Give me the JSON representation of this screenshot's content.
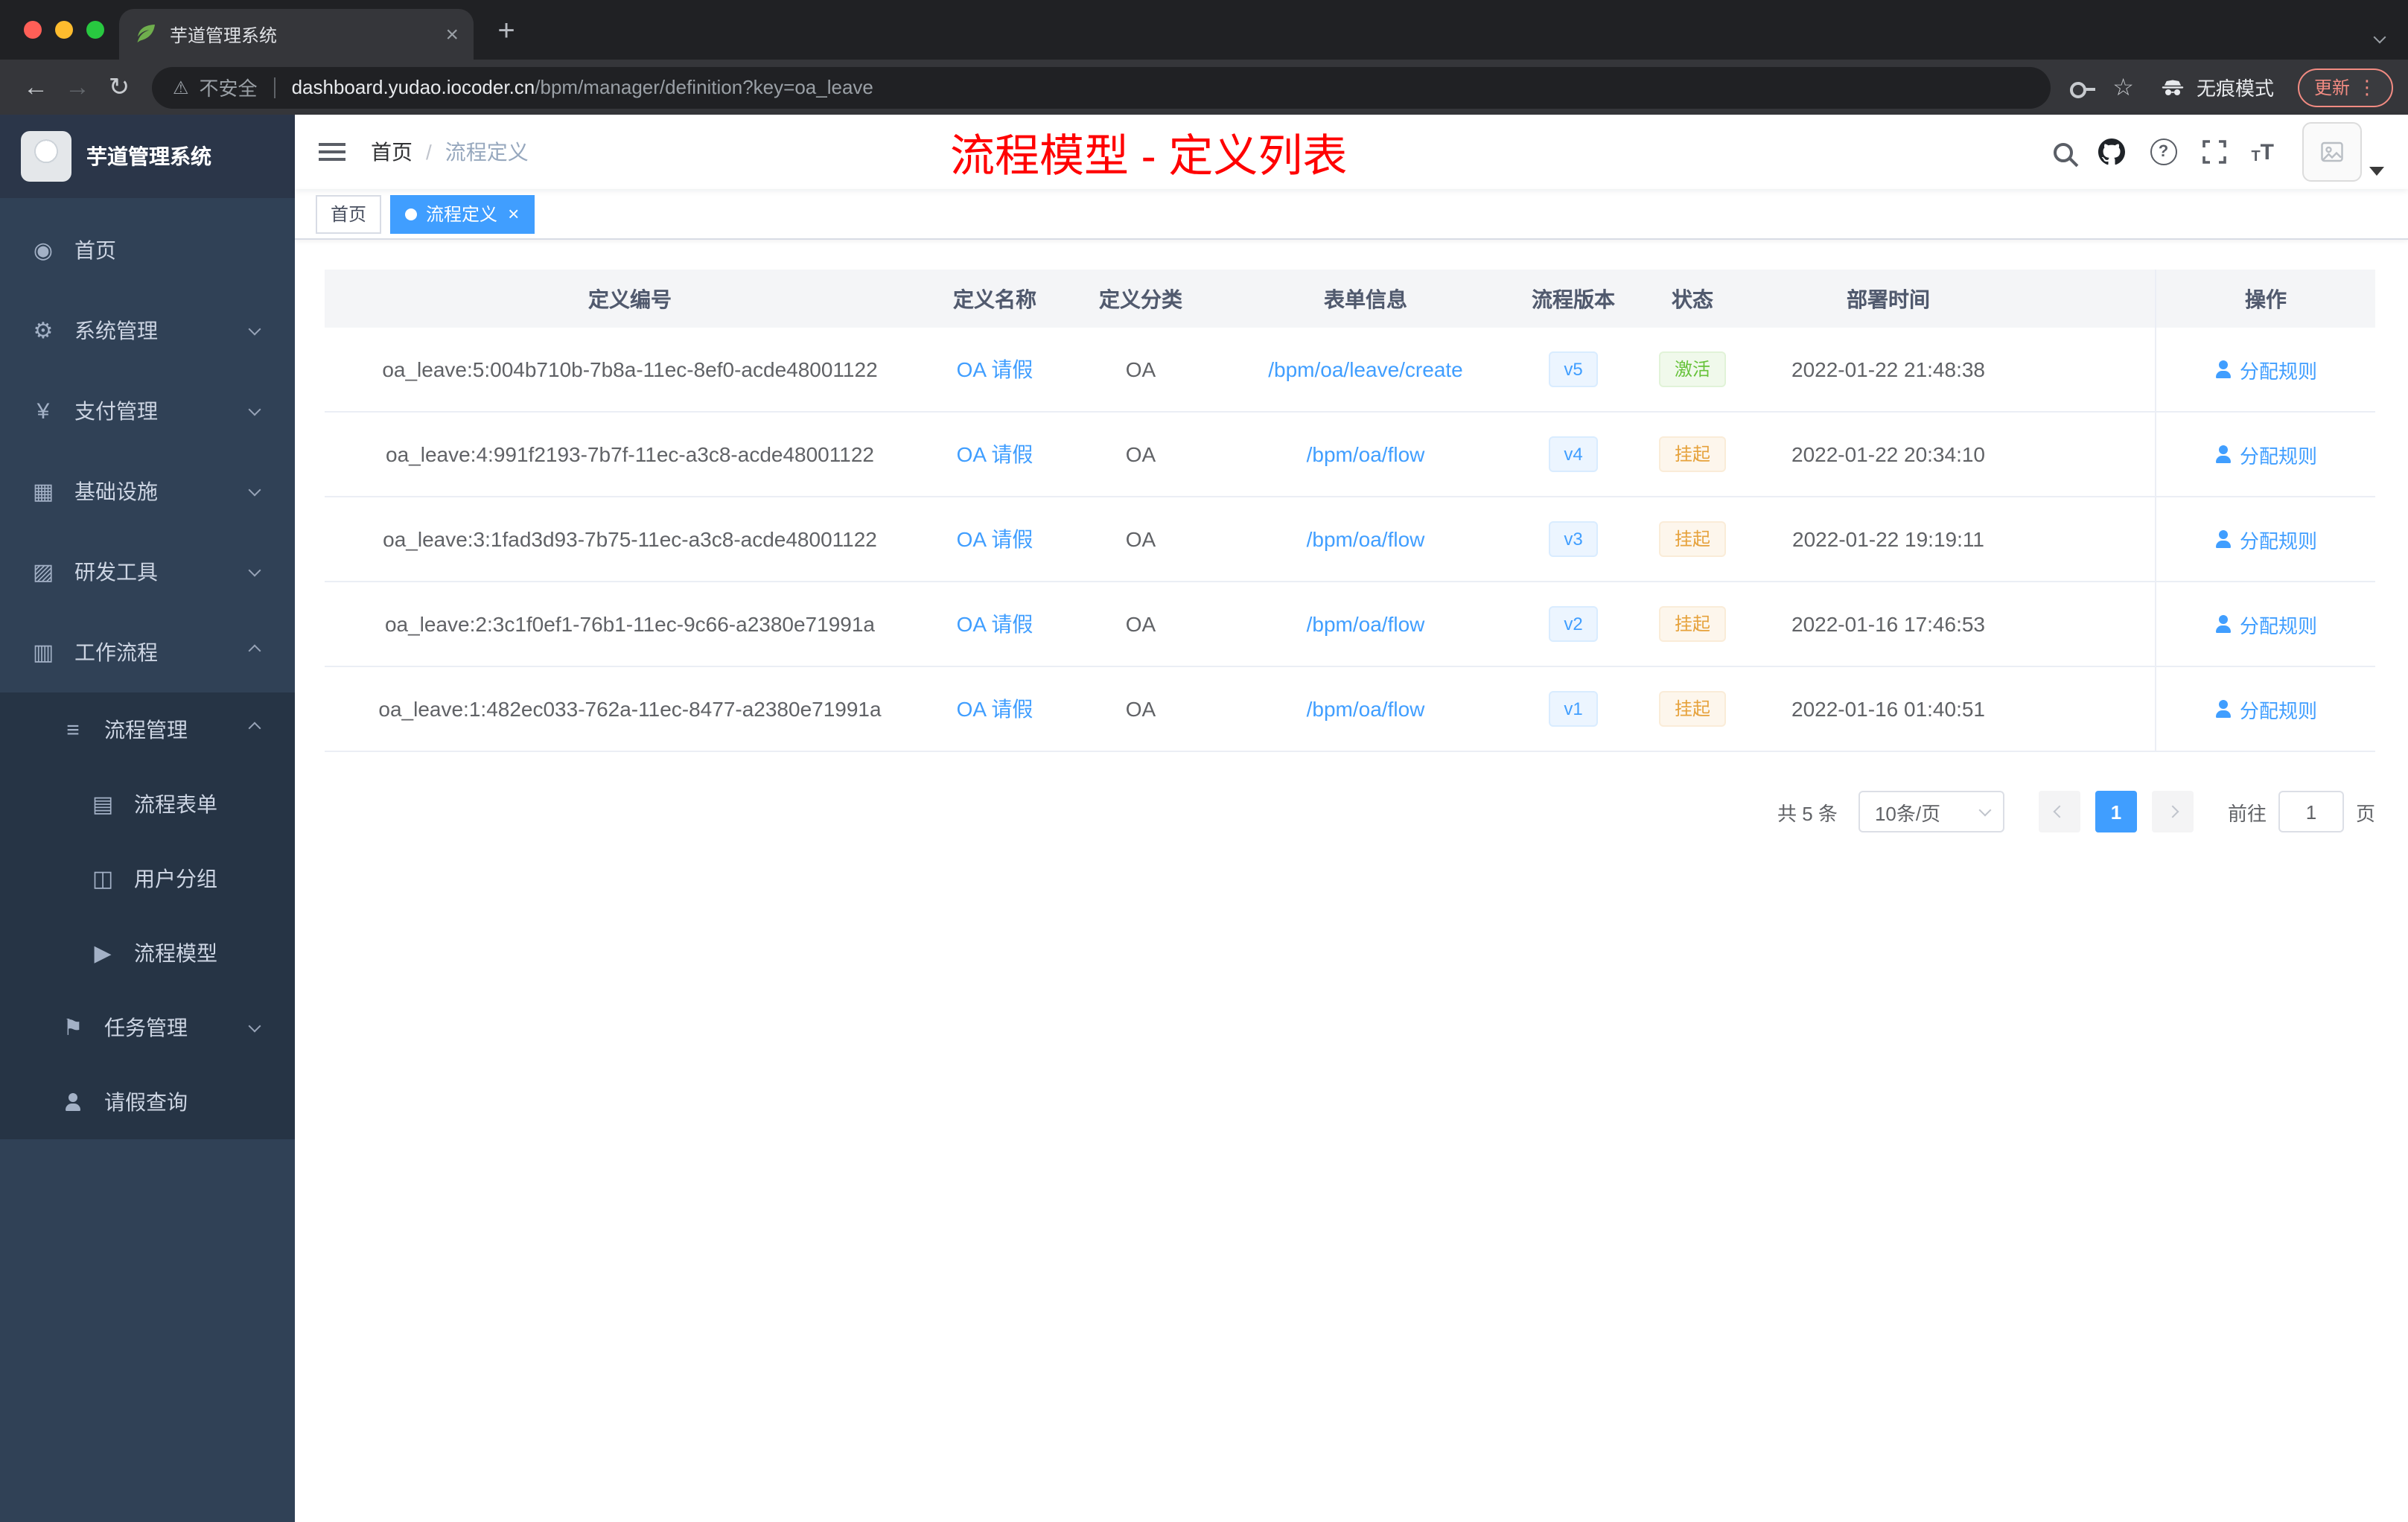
{
  "colors": {
    "accent": "#409eff",
    "annotation_red": "#ff0000",
    "status_active_green": "#67c23a",
    "status_suspend_orange": "#e6a23c"
  },
  "browser": {
    "tab_title": "芋道管理系统",
    "security_label": "不安全",
    "url_domain": "dashboard.yudao.iocoder.cn",
    "url_path": "/bpm/manager/definition?key=oa_leave",
    "incognito_label": "无痕模式",
    "update_label": "更新"
  },
  "sidebar": {
    "logo_title": "芋道管理系统",
    "items": [
      {
        "key": "home",
        "label": "首页",
        "icon": "dashboard",
        "level": 1
      },
      {
        "key": "system",
        "label": "系统管理",
        "icon": "gear",
        "level": 1,
        "arrow": "down"
      },
      {
        "key": "payment",
        "label": "支付管理",
        "icon": "yen",
        "level": 1,
        "arrow": "down"
      },
      {
        "key": "infra",
        "label": "基础设施",
        "icon": "infra",
        "level": 1,
        "arrow": "down"
      },
      {
        "key": "devtools",
        "label": "研发工具",
        "icon": "tool",
        "level": 1,
        "arrow": "down"
      },
      {
        "key": "workflow",
        "label": "工作流程",
        "icon": "workflow",
        "level": 1,
        "arrow": "up"
      },
      {
        "key": "process-mgmt",
        "label": "流程管理",
        "icon": "list",
        "level": 2,
        "arrow": "up"
      },
      {
        "key": "process-form",
        "label": "流程表单",
        "icon": "form",
        "level": 3
      },
      {
        "key": "user-group",
        "label": "用户分组",
        "icon": "group",
        "level": 3
      },
      {
        "key": "process-model",
        "label": "流程模型",
        "icon": "send",
        "level": 3
      },
      {
        "key": "task-mgmt",
        "label": "任务管理",
        "icon": "task",
        "level": 2,
        "arrow": "down"
      },
      {
        "key": "leave-query",
        "label": "请假查询",
        "icon": "user",
        "level": 2
      }
    ]
  },
  "navbar": {
    "breadcrumb": [
      "首页",
      "流程定义"
    ],
    "annotation": "流程模型 - 定义列表"
  },
  "tags": [
    {
      "label": "首页",
      "active": false
    },
    {
      "label": "流程定义",
      "active": true
    }
  ],
  "table": {
    "columns": [
      "定义编号",
      "定义名称",
      "定义分类",
      "表单信息",
      "流程版本",
      "状态",
      "部署时间",
      "操作"
    ],
    "rows": [
      {
        "id": "oa_leave:5:004b710b-7b8a-11ec-8ef0-acde48001122",
        "name": "OA 请假",
        "category": "OA",
        "form": "/bpm/oa/leave/create",
        "version": "v5",
        "status": "激活",
        "status_type": "success",
        "time": "2022-01-22 21:48:38",
        "action": "分配规则"
      },
      {
        "id": "oa_leave:4:991f2193-7b7f-11ec-a3c8-acde48001122",
        "name": "OA 请假",
        "category": "OA",
        "form": "/bpm/oa/flow",
        "version": "v4",
        "status": "挂起",
        "status_type": "warning",
        "time": "2022-01-22 20:34:10",
        "action": "分配规则"
      },
      {
        "id": "oa_leave:3:1fad3d93-7b75-11ec-a3c8-acde48001122",
        "name": "OA 请假",
        "category": "OA",
        "form": "/bpm/oa/flow",
        "version": "v3",
        "status": "挂起",
        "status_type": "warning",
        "time": "2022-01-22 19:19:11",
        "action": "分配规则"
      },
      {
        "id": "oa_leave:2:3c1f0ef1-76b1-11ec-9c66-a2380e71991a",
        "name": "OA 请假",
        "category": "OA",
        "form": "/bpm/oa/flow",
        "version": "v2",
        "status": "挂起",
        "status_type": "warning",
        "time": "2022-01-16 17:46:53",
        "action": "分配规则"
      },
      {
        "id": "oa_leave:1:482ec033-762a-11ec-8477-a2380e71991a",
        "name": "OA 请假",
        "category": "OA",
        "form": "/bpm/oa/flow",
        "version": "v1",
        "status": "挂起",
        "status_type": "warning",
        "time": "2022-01-16 01:40:51",
        "action": "分配规则"
      }
    ]
  },
  "pagination": {
    "total": "共 5 条",
    "page_size": "10条/页",
    "current_page": "1",
    "goto_label": "前往",
    "goto_value": "1",
    "page_unit": "页"
  }
}
